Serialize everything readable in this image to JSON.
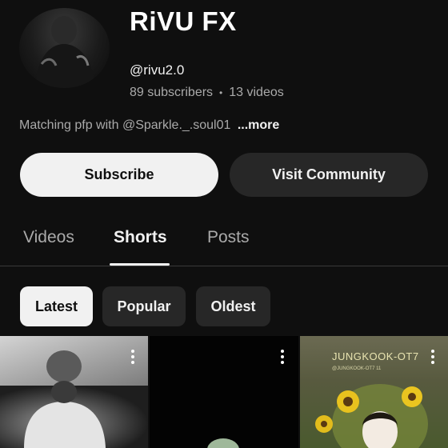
{
  "channel": {
    "name": "RiVU FX",
    "handle": "@rivu2.0",
    "subscribers": "89 subscribers",
    "separator": "•",
    "videos": "13 videos",
    "description": "Matching pfp with @Sparkle._.soul01",
    "more_label": "...more"
  },
  "actions": {
    "subscribe_label": "Subscribe",
    "community_label": "Visit Community"
  },
  "tabs": [
    {
      "label": "Videos",
      "active": false
    },
    {
      "label": "Shorts",
      "active": true
    },
    {
      "label": "Posts",
      "active": false
    }
  ],
  "filters": [
    {
      "label": "Latest",
      "active": true
    },
    {
      "label": "Popular",
      "active": false
    },
    {
      "label": "Oldest",
      "active": false
    }
  ],
  "shorts": [
    {
      "icon": "kebab-menu-icon",
      "overlay_title": "",
      "overlay_sub": ""
    },
    {
      "icon": "kebab-menu-icon",
      "overlay_title": "",
      "overlay_sub": ""
    },
    {
      "icon": "kebab-menu-icon",
      "overlay_title": "JUNGKOOK-OT7",
      "overlay_sub": "@JUNGKOOK-OT7 11"
    }
  ],
  "colors": {
    "background": "#0f0f0f",
    "primary_button": "#f1f1f1",
    "secondary_button": "#272727",
    "secondary_text": "#aaaaaa"
  }
}
